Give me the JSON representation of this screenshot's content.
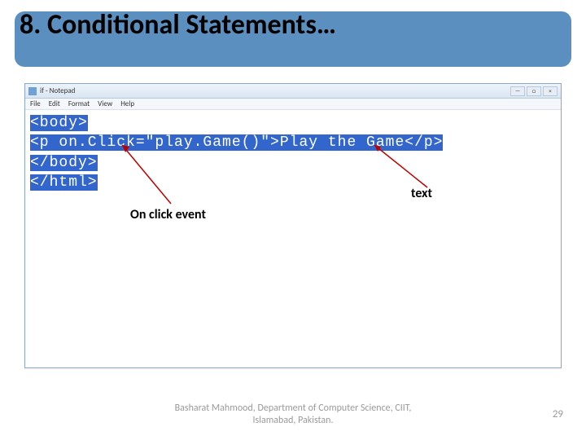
{
  "title": "8. Conditional Statements…",
  "notepad": {
    "window_title": "if - Notepad",
    "menu": [
      "File",
      "Edit",
      "Format",
      "View",
      "Help"
    ],
    "code_lines": [
      "<body>",
      "<p on.Click=\"play.Game()\">Play the Game</p>",
      "</body>",
      "</html>"
    ]
  },
  "annotations": {
    "text_label": "text",
    "onclick_label": "On click event"
  },
  "footer": {
    "author": "Basharat Mahmood, Department of Computer Science, CIIT, Islamabad, Pakistan.",
    "page": "29"
  }
}
